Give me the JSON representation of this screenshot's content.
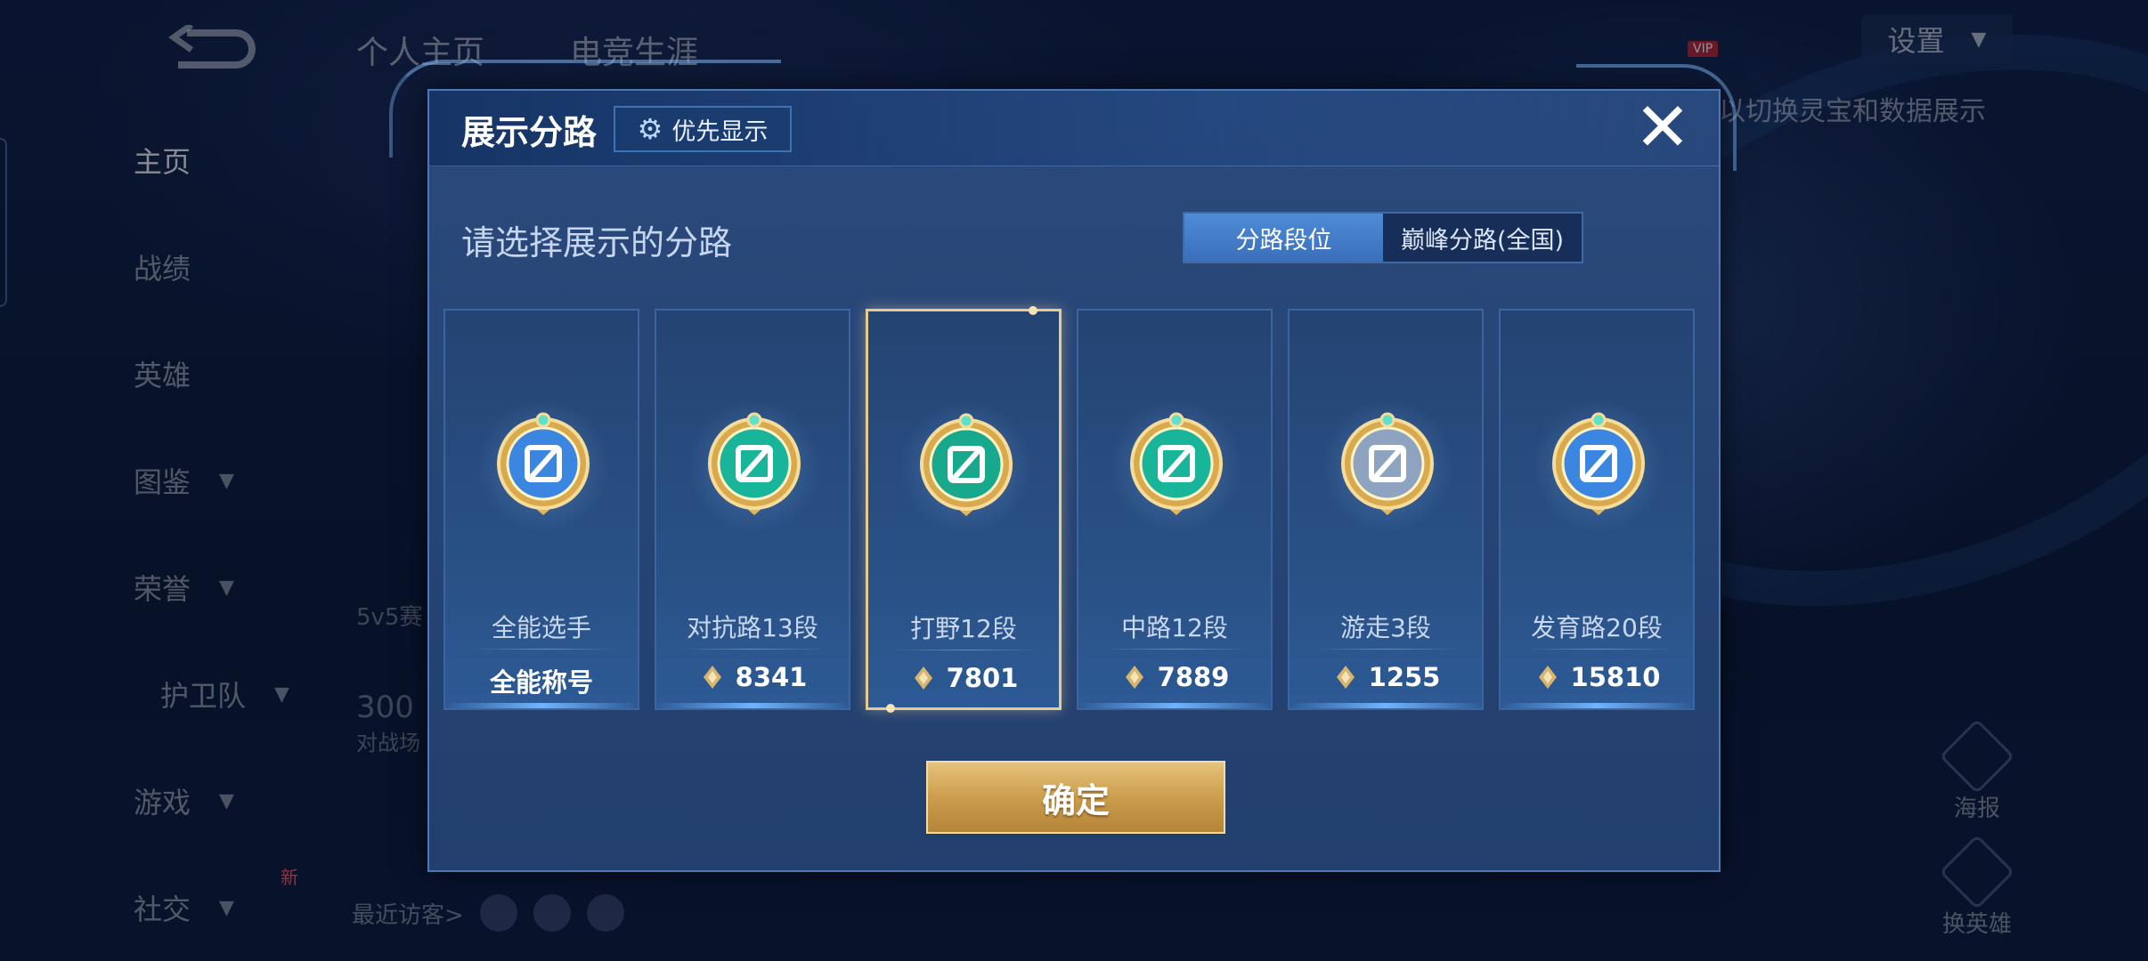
{
  "background": {
    "top_tabs": [
      "个人主页",
      "电竞生涯"
    ],
    "nav_items": [
      {
        "label": "主页",
        "has_chevron": false
      },
      {
        "label": "战绩",
        "has_chevron": false
      },
      {
        "label": "英雄",
        "has_chevron": false
      },
      {
        "label": "图鉴",
        "has_chevron": true
      },
      {
        "label": "荣誉",
        "has_chevron": true
      },
      {
        "label": "护卫队",
        "has_chevron": true
      },
      {
        "label": "游戏",
        "has_chevron": true
      },
      {
        "label": "社交",
        "has_chevron": true
      }
    ],
    "new_badge": "新",
    "settings_label": "设置",
    "vip_label": "VIP",
    "hint_text": "以切换灵宝和数据展示",
    "stat_line_1": "5v5赛",
    "stat_number": "300",
    "stat_line_2": "对战场",
    "visitors_label": "最近访客>",
    "right_buttons": [
      "海报",
      "换英雄"
    ]
  },
  "modal": {
    "title": "展示分路",
    "priority_label": "优先显示",
    "prompt": "请选择展示的分路",
    "tabs": [
      {
        "label": "分路段位",
        "active": true
      },
      {
        "label": "巅峰分路(全国)",
        "active": false
      }
    ],
    "cards": [
      {
        "label": "全能选手",
        "value": "全能称号",
        "show_points_icon": false,
        "selected": false,
        "badge_color": "#3a86e0",
        "badge_icon": "all-round-icon"
      },
      {
        "label": "对抗路13段",
        "value": "8341",
        "show_points_icon": true,
        "selected": false,
        "badge_color": "#19b59a",
        "badge_icon": "clash-lane-icon"
      },
      {
        "label": "打野12段",
        "value": "7801",
        "show_points_icon": true,
        "selected": true,
        "badge_color": "#18a88c",
        "badge_icon": "jungle-icon"
      },
      {
        "label": "中路12段",
        "value": "7889",
        "show_points_icon": true,
        "selected": false,
        "badge_color": "#19b59a",
        "badge_icon": "mid-lane-icon"
      },
      {
        "label": "游走3段",
        "value": "1255",
        "show_points_icon": true,
        "selected": false,
        "badge_color": "#8ea3bf",
        "badge_icon": "roam-icon"
      },
      {
        "label": "发育路20段",
        "value": "15810",
        "show_points_icon": true,
        "selected": false,
        "badge_color": "#3a86e0",
        "badge_icon": "farm-lane-icon"
      }
    ],
    "confirm_label": "确定"
  },
  "colors": {
    "modal_bg": "#2b4a7c",
    "accent_blue": "#4f8bd6",
    "gold": "#e6c27a",
    "selected_border": "#e8c98f"
  }
}
